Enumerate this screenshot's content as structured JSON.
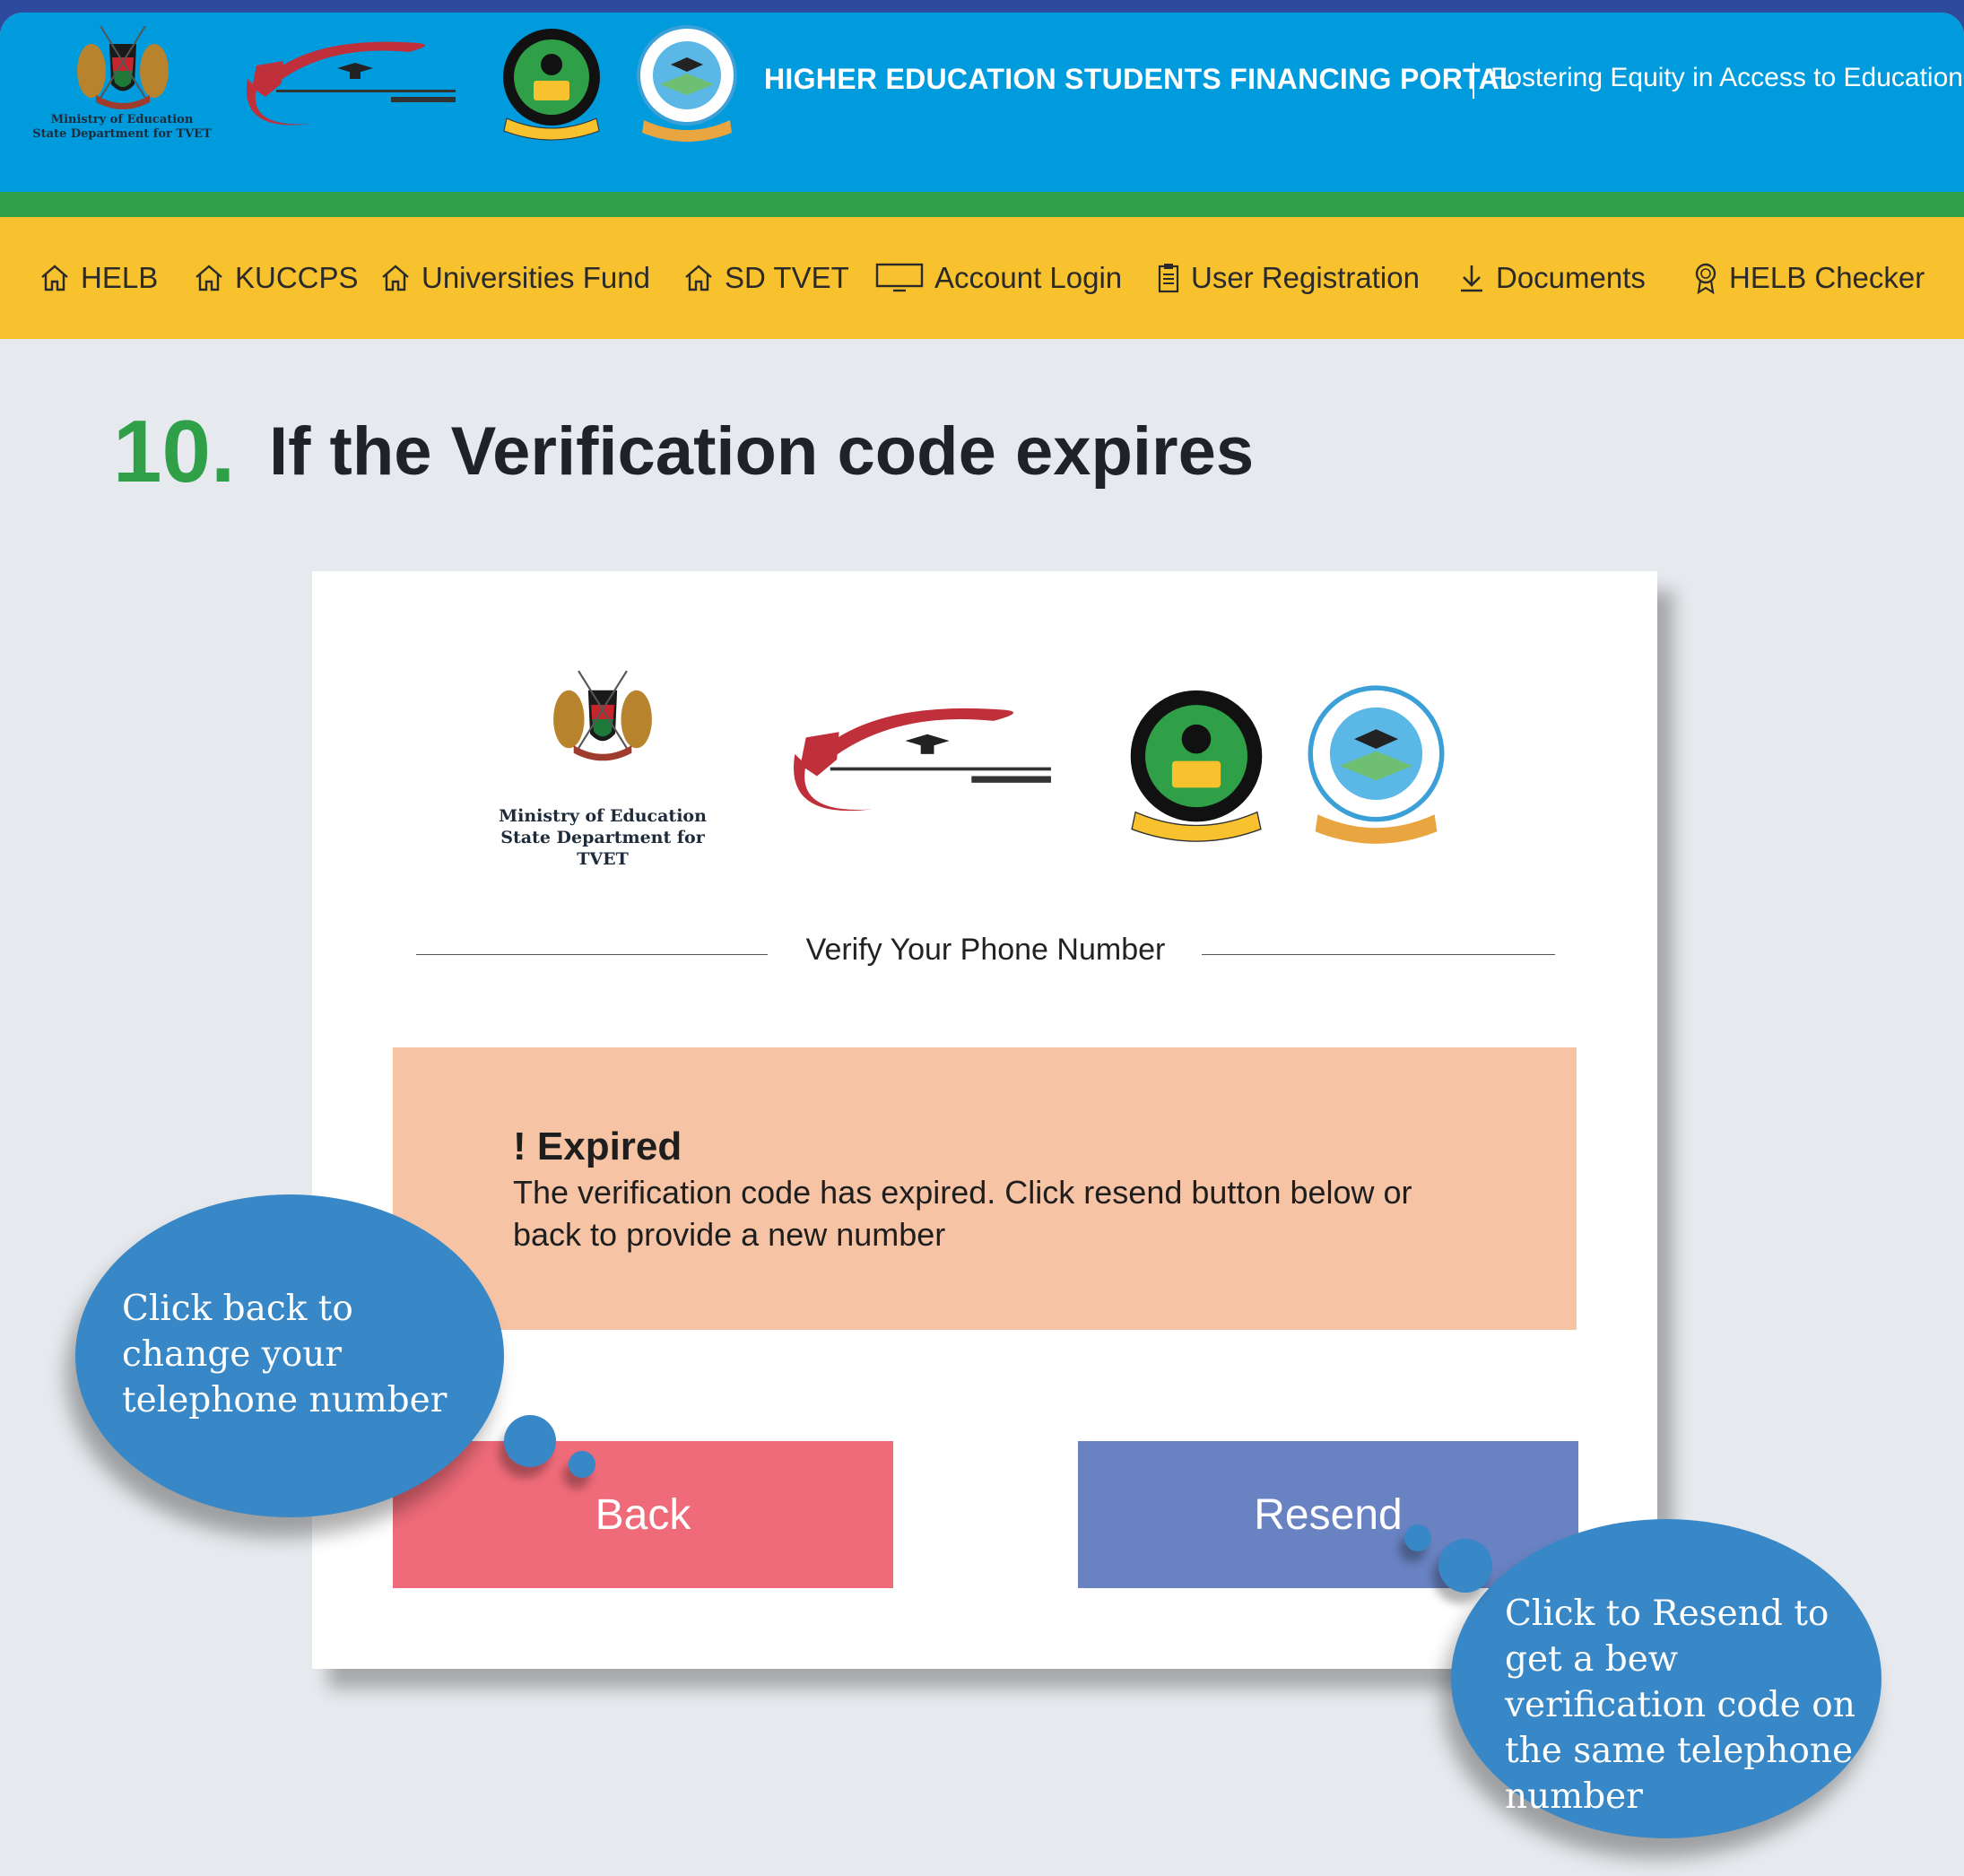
{
  "colors": {
    "header_blue": "#009bdc",
    "header_green": "#2f9f48",
    "nav_yellow": "#f8c22e",
    "step_number_green": "#2f9f48",
    "alert_bg": "#f6c4a4",
    "back_button": "#ef6b79",
    "resend_button": "#6982c2",
    "callout_blue": "#3887c7"
  },
  "header": {
    "ministry_line1": "Ministry of Education",
    "ministry_line2": "State Department for TVET",
    "portal_title": "HIGHER EDUCATION STUDENTS FINANCING PORTAL",
    "portal_tagline": "Fostering Equity in Access to Education",
    "logos": [
      "kenya-coat-of-arms",
      "kuccps-logo",
      "helb-logo",
      "universities-fund-logo"
    ]
  },
  "nav": {
    "items": [
      {
        "label": "HELB",
        "icon": "home-icon"
      },
      {
        "label": "KUCCPS",
        "icon": "home-icon"
      },
      {
        "label": "Universities Fund",
        "icon": "home-icon"
      },
      {
        "label": "SD TVET",
        "icon": "home-icon"
      },
      {
        "label": "Account Login",
        "icon": "monitor-icon"
      },
      {
        "label": "User Registration",
        "icon": "clipboard-icon"
      },
      {
        "label": "Documents",
        "icon": "download-icon"
      },
      {
        "label": "HELB Checker",
        "icon": "badge-icon"
      }
    ]
  },
  "step": {
    "number": "10.",
    "title": "If the Verification code expires"
  },
  "card": {
    "ministry_line1": "Ministry of Education",
    "ministry_line2": "State Department for TVET",
    "section_title": "Verify Your Phone Number",
    "alert": {
      "title": "! Expired",
      "message": "The verification code has expired. Click resend button below or back to provide a new number"
    },
    "back_label": "Back",
    "resend_label": "Resend"
  },
  "callouts": {
    "back": "Click back to change your telephone number",
    "resend": "Click to Resend to get a bew verification code on the same telephone number"
  }
}
